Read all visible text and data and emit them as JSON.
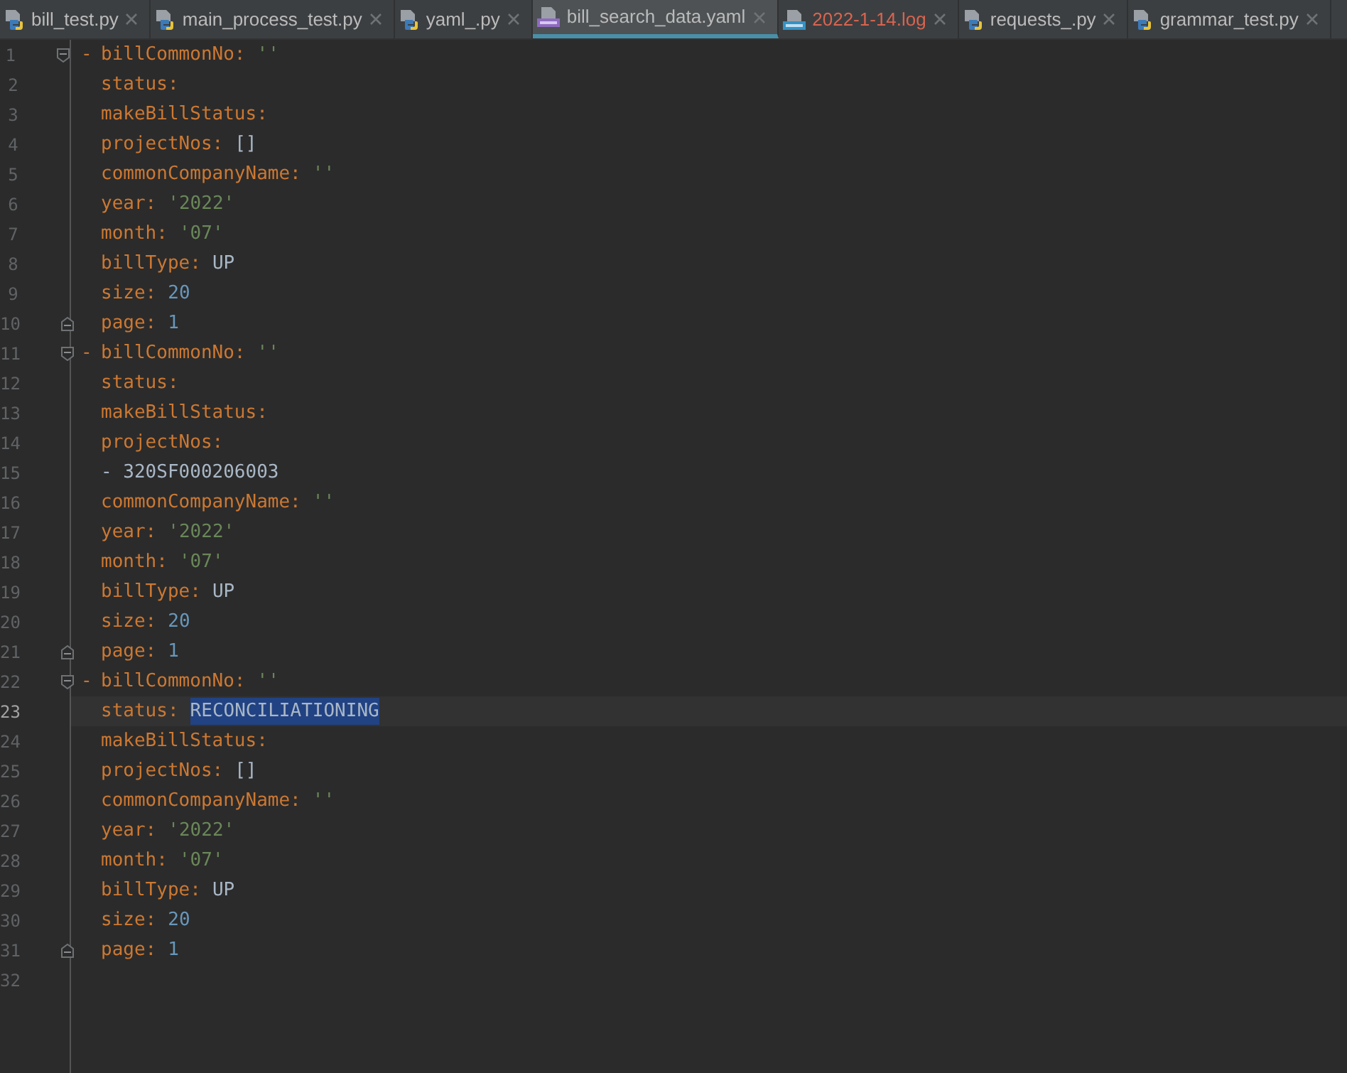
{
  "tabs": [
    {
      "label": "bill_test.py",
      "kind": "py",
      "selected": false,
      "error": false
    },
    {
      "label": "main_process_test.py",
      "kind": "py",
      "selected": false,
      "error": false
    },
    {
      "label": "yaml_.py",
      "kind": "py",
      "selected": false,
      "error": false
    },
    {
      "label": "bill_search_data.yaml",
      "kind": "yaml",
      "selected": true,
      "error": false
    },
    {
      "label": "2022-1-14.log",
      "kind": "log",
      "selected": false,
      "error": true
    },
    {
      "label": "requests_.py",
      "kind": "py",
      "selected": false,
      "error": false
    },
    {
      "label": "grammar_test.py",
      "kind": "py",
      "selected": false,
      "error": false
    }
  ],
  "editor": {
    "lines": [
      {
        "number": "1",
        "current": false,
        "fold_start": true,
        "fold_end": false,
        "dash": "-",
        "key": "billCommonNo:",
        "value": {
          "text": "''",
          "kind": "string",
          "selected": false
        }
      },
      {
        "number": "2",
        "current": false,
        "fold_start": false,
        "fold_end": false,
        "key": "status:"
      },
      {
        "number": "3",
        "current": false,
        "fold_start": false,
        "fold_end": false,
        "key": "makeBillStatus:"
      },
      {
        "number": "4",
        "current": false,
        "fold_start": false,
        "fold_end": false,
        "key": "projectNos:",
        "value": {
          "text": "[]",
          "kind": "plain",
          "selected": false
        }
      },
      {
        "number": "5",
        "current": false,
        "fold_start": false,
        "fold_end": false,
        "key": "commonCompanyName:",
        "value": {
          "text": "''",
          "kind": "string",
          "selected": false
        }
      },
      {
        "number": "6",
        "current": false,
        "fold_start": false,
        "fold_end": false,
        "key": "year:",
        "value": {
          "text": "'2022'",
          "kind": "string",
          "selected": false
        }
      },
      {
        "number": "7",
        "current": false,
        "fold_start": false,
        "fold_end": false,
        "key": "month:",
        "value": {
          "text": "'07'",
          "kind": "string",
          "selected": false
        }
      },
      {
        "number": "8",
        "current": false,
        "fold_start": false,
        "fold_end": false,
        "key": "billType:",
        "value": {
          "text": "UP",
          "kind": "plain",
          "selected": false
        }
      },
      {
        "number": "9",
        "current": false,
        "fold_start": false,
        "fold_end": false,
        "key": "size:",
        "value": {
          "text": "20",
          "kind": "number",
          "selected": false
        }
      },
      {
        "number": "10",
        "current": false,
        "fold_start": false,
        "fold_end": true,
        "key": "page:",
        "value": {
          "text": "1",
          "kind": "number",
          "selected": false
        }
      },
      {
        "number": "11",
        "current": false,
        "fold_start": true,
        "fold_end": false,
        "dash": "-",
        "key": "billCommonNo:",
        "value": {
          "text": "''",
          "kind": "string",
          "selected": false
        }
      },
      {
        "number": "12",
        "current": false,
        "fold_start": false,
        "fold_end": false,
        "key": "status:"
      },
      {
        "number": "13",
        "current": false,
        "fold_start": false,
        "fold_end": false,
        "key": "makeBillStatus:"
      },
      {
        "number": "14",
        "current": false,
        "fold_start": false,
        "fold_end": false,
        "key": "projectNos:"
      },
      {
        "number": "15",
        "current": false,
        "fold_start": false,
        "fold_end": false,
        "value": {
          "text": "- 320SF000206003",
          "kind": "plain",
          "selected": false
        }
      },
      {
        "number": "16",
        "current": false,
        "fold_start": false,
        "fold_end": false,
        "key": "commonCompanyName:",
        "value": {
          "text": "''",
          "kind": "string",
          "selected": false
        }
      },
      {
        "number": "17",
        "current": false,
        "fold_start": false,
        "fold_end": false,
        "key": "year:",
        "value": {
          "text": "'2022'",
          "kind": "string",
          "selected": false
        }
      },
      {
        "number": "18",
        "current": false,
        "fold_start": false,
        "fold_end": false,
        "key": "month:",
        "value": {
          "text": "'07'",
          "kind": "string",
          "selected": false
        }
      },
      {
        "number": "19",
        "current": false,
        "fold_start": false,
        "fold_end": false,
        "key": "billType:",
        "value": {
          "text": "UP",
          "kind": "plain",
          "selected": false
        }
      },
      {
        "number": "20",
        "current": false,
        "fold_start": false,
        "fold_end": false,
        "key": "size:",
        "value": {
          "text": "20",
          "kind": "number",
          "selected": false
        }
      },
      {
        "number": "21",
        "current": false,
        "fold_start": false,
        "fold_end": true,
        "key": "page:",
        "value": {
          "text": "1",
          "kind": "number",
          "selected": false
        }
      },
      {
        "number": "22",
        "current": false,
        "fold_start": true,
        "fold_end": false,
        "dash": "-",
        "key": "billCommonNo:",
        "value": {
          "text": "''",
          "kind": "string",
          "selected": false
        }
      },
      {
        "number": "23",
        "current": true,
        "fold_start": false,
        "fold_end": false,
        "key": "status:",
        "value": {
          "text": "RECONCILIATIONING",
          "kind": "plain",
          "selected": true
        }
      },
      {
        "number": "24",
        "current": false,
        "fold_start": false,
        "fold_end": false,
        "key": "makeBillStatus:"
      },
      {
        "number": "25",
        "current": false,
        "fold_start": false,
        "fold_end": false,
        "key": "projectNos:",
        "value": {
          "text": "[]",
          "kind": "plain",
          "selected": false
        }
      },
      {
        "number": "26",
        "current": false,
        "fold_start": false,
        "fold_end": false,
        "key": "commonCompanyName:",
        "value": {
          "text": "''",
          "kind": "string",
          "selected": false
        }
      },
      {
        "number": "27",
        "current": false,
        "fold_start": false,
        "fold_end": false,
        "key": "year:",
        "value": {
          "text": "'2022'",
          "kind": "string",
          "selected": false
        }
      },
      {
        "number": "28",
        "current": false,
        "fold_start": false,
        "fold_end": false,
        "key": "month:",
        "value": {
          "text": "'07'",
          "kind": "string",
          "selected": false
        }
      },
      {
        "number": "29",
        "current": false,
        "fold_start": false,
        "fold_end": false,
        "key": "billType:",
        "value": {
          "text": "UP",
          "kind": "plain",
          "selected": false
        }
      },
      {
        "number": "30",
        "current": false,
        "fold_start": false,
        "fold_end": false,
        "key": "size:",
        "value": {
          "text": "20",
          "kind": "number",
          "selected": false
        }
      },
      {
        "number": "31",
        "current": false,
        "fold_start": false,
        "fold_end": true,
        "key": "page:",
        "value": {
          "text": "1",
          "kind": "number",
          "selected": false
        }
      },
      {
        "number": "32",
        "current": false,
        "fold_start": false,
        "fold_end": false
      }
    ]
  }
}
